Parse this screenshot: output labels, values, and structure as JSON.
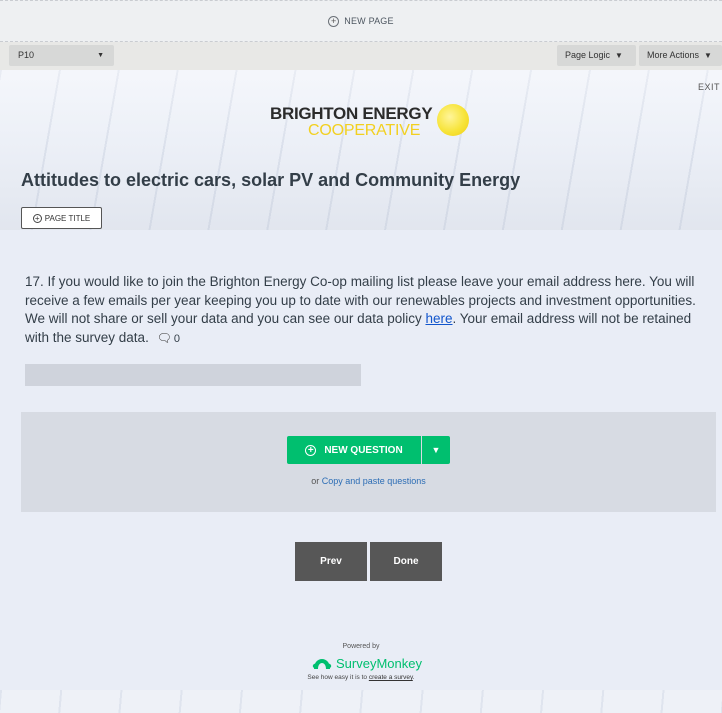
{
  "top_bar": {
    "new_page_label": "NEW PAGE"
  },
  "toolbar": {
    "page_select_value": "P10",
    "page_logic_label": "Page Logic",
    "more_actions_label": "More Actions"
  },
  "header": {
    "exit_label": "EXIT",
    "logo_line1": "BRIGHTON ENERGY",
    "logo_line2": "COOPERATIVE",
    "survey_title": "Attitudes to electric cars, solar PV and Community Energy",
    "page_title_button": "PAGE TITLE"
  },
  "question": {
    "text_before_link": "17. If you would like to join the Brighton Energy Co-op mailing list please leave your email address here. You will receive a few emails per year keeping you up to date with our renewables projects and investment opportunities. We will not share or sell your data and you can see our data policy ",
    "link_text": "here",
    "text_after_link": ". Your email address will not be retained with the survey data.",
    "comment_count": "0",
    "input_value": ""
  },
  "new_question": {
    "button_label": "NEW QUESTION",
    "or_text": "or",
    "copy_paste_link": "Copy and paste questions"
  },
  "navigation": {
    "prev_label": "Prev",
    "done_label": "Done"
  },
  "footer": {
    "powered_by": "Powered by",
    "brand": "SurveyMonkey",
    "see_easy_text": "See how easy it is to",
    "create_link": "create a survey",
    "trailing_period": "."
  },
  "colors": {
    "accent_green": "#00bf6f",
    "nav_button": "#575757",
    "logo_yellow": "#f2d020"
  }
}
